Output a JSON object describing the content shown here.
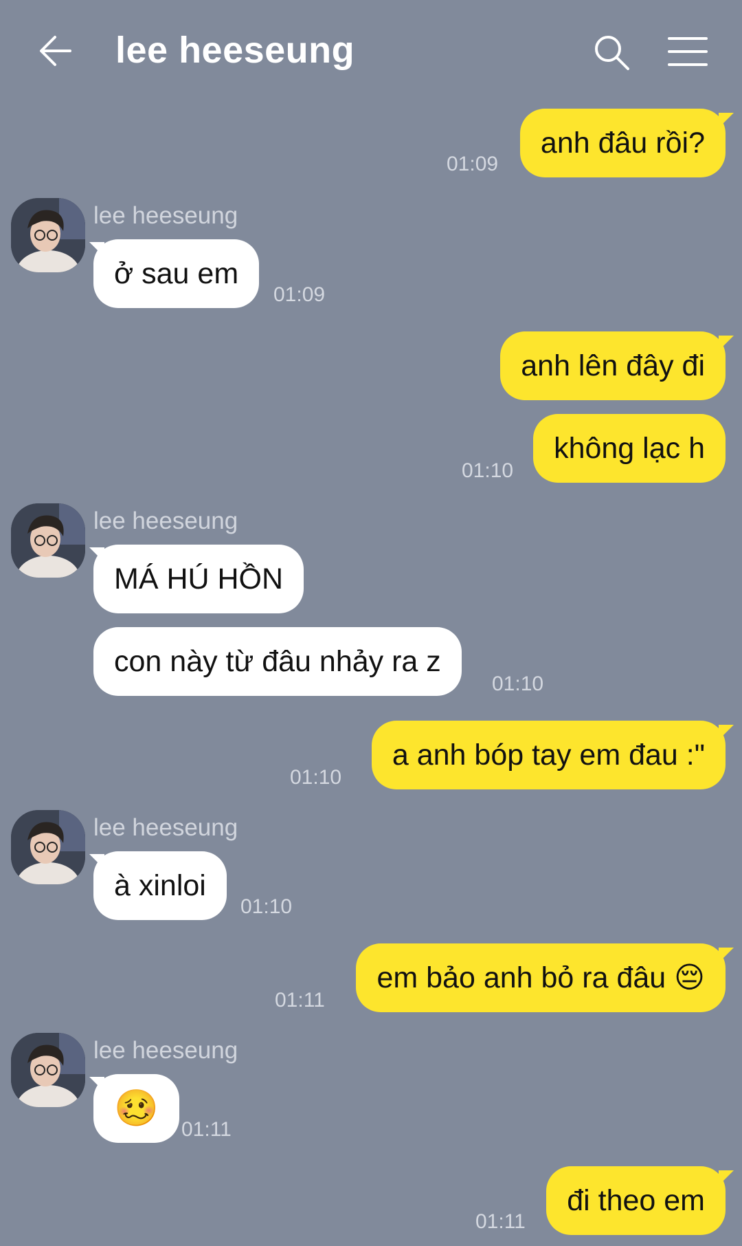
{
  "header": {
    "title": "lee heeseung",
    "back_icon": "arrow-left-icon",
    "search_icon": "search-icon",
    "menu_icon": "hamburger-menu-icon"
  },
  "colors": {
    "background": "#818a9b",
    "my_bubble": "#fde52d",
    "their_bubble": "#ffffff"
  },
  "messages": [
    {
      "from": "me",
      "text": "anh đâu rồi?",
      "time": "01:09"
    },
    {
      "from": "them",
      "sender": "lee heeseung",
      "text": "ở sau em",
      "time": "01:09"
    },
    {
      "from": "me",
      "text": "anh lên đây đi"
    },
    {
      "from": "me",
      "text": "không lạc h",
      "time": "01:10"
    },
    {
      "from": "them",
      "sender": "lee heeseung",
      "text": "MÁ HÚ HỒN"
    },
    {
      "from": "them",
      "text": "con này từ đâu nhảy ra z",
      "time": "01:10"
    },
    {
      "from": "me",
      "text": "a anh bóp tay em đau :\"",
      "time": "01:10"
    },
    {
      "from": "them",
      "sender": "lee heeseung",
      "text": "à xinloi",
      "time": "01:10"
    },
    {
      "from": "me",
      "text": "em bảo anh bỏ ra đâu 😔",
      "time": "01:11"
    },
    {
      "from": "them",
      "sender": "lee heeseung",
      "text": "🥴",
      "time": "01:11"
    },
    {
      "from": "me",
      "text": "đi theo em",
      "time": "01:11"
    }
  ]
}
